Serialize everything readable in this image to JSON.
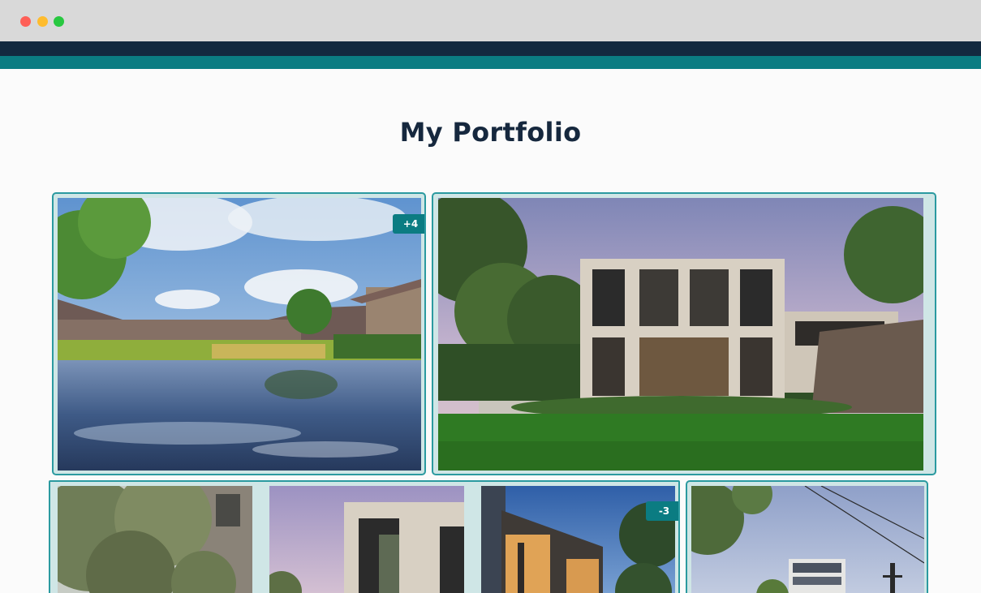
{
  "window": {
    "controls": [
      "close",
      "minimize",
      "maximize"
    ]
  },
  "colors": {
    "navbar": "#13293f",
    "accent": "#0b7c82",
    "title": "#16283e",
    "card_border": "#2b9aa0"
  },
  "page": {
    "title": "My Portfolio"
  },
  "gallery": {
    "row1": [
      {
        "subject": "villa-pool-photo",
        "badge": "+4"
      },
      {
        "subject": "modern-house-garden-photo"
      }
    ],
    "row2": [
      {
        "subject": "tree-facade-photo"
      },
      {
        "subject": "stone-facade-dusk-photo"
      },
      {
        "subject": "night-house-photo",
        "badge": "-3"
      },
      {
        "subject": "apartment-building-photo"
      }
    ]
  }
}
